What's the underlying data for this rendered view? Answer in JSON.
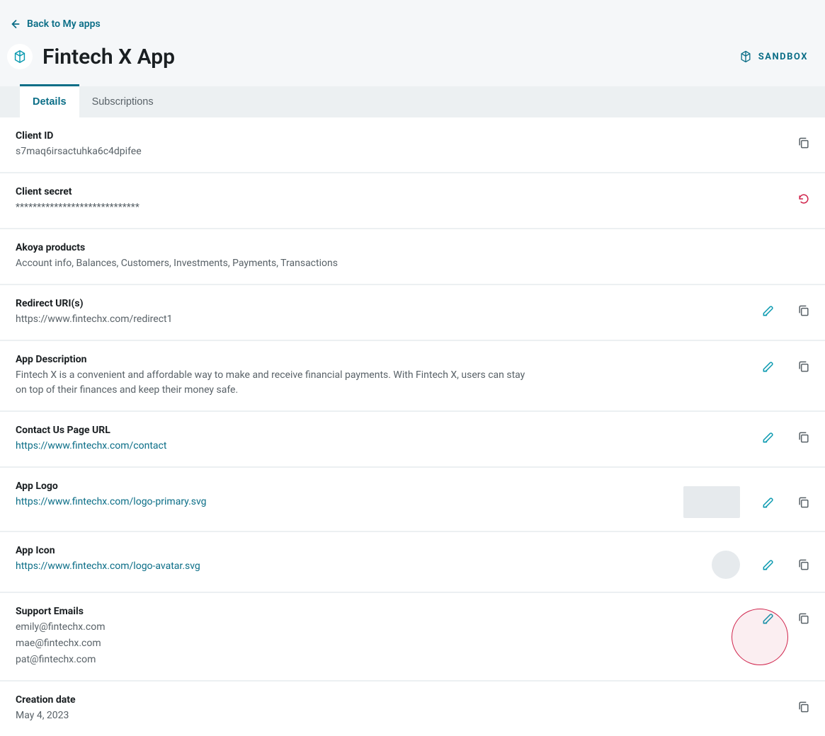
{
  "back_link": "Back to My apps",
  "app_name": "Fintech X App",
  "environment_badge": "SANDBOX",
  "tabs": {
    "details": "Details",
    "subscriptions": "Subscriptions"
  },
  "details": {
    "client_id": {
      "label": "Client ID",
      "value": "s7maq6irsactuhka6c4dpifee"
    },
    "client_secret": {
      "label": "Client secret",
      "value": "*****************************"
    },
    "products": {
      "label": "Akoya products",
      "value": "Account info, Balances, Customers, Investments, Payments, Transactions"
    },
    "redirect_uris": {
      "label": "Redirect URI(s)",
      "value": "https://www.fintechx.com/redirect1"
    },
    "description": {
      "label": "App Description",
      "value": "Fintech X is a convenient and affordable way to make and receive financial payments. With Fintech X, users can stay on top of their finances and keep their money safe."
    },
    "contact_url": {
      "label": "Contact Us Page URL",
      "value": "https://www.fintechx.com/contact"
    },
    "app_logo": {
      "label": "App Logo",
      "value": "https://www.fintechx.com/logo-primary.svg"
    },
    "app_icon": {
      "label": "App Icon",
      "value": "https://www.fintechx.com/logo-avatar.svg"
    },
    "support_emails": {
      "label": "Support Emails",
      "values": [
        "emily@fintechx.com",
        "mae@fintechx.com",
        "pat@fintechx.com"
      ]
    },
    "creation_date": {
      "label": "Creation date",
      "value": "May 4, 2023"
    }
  }
}
